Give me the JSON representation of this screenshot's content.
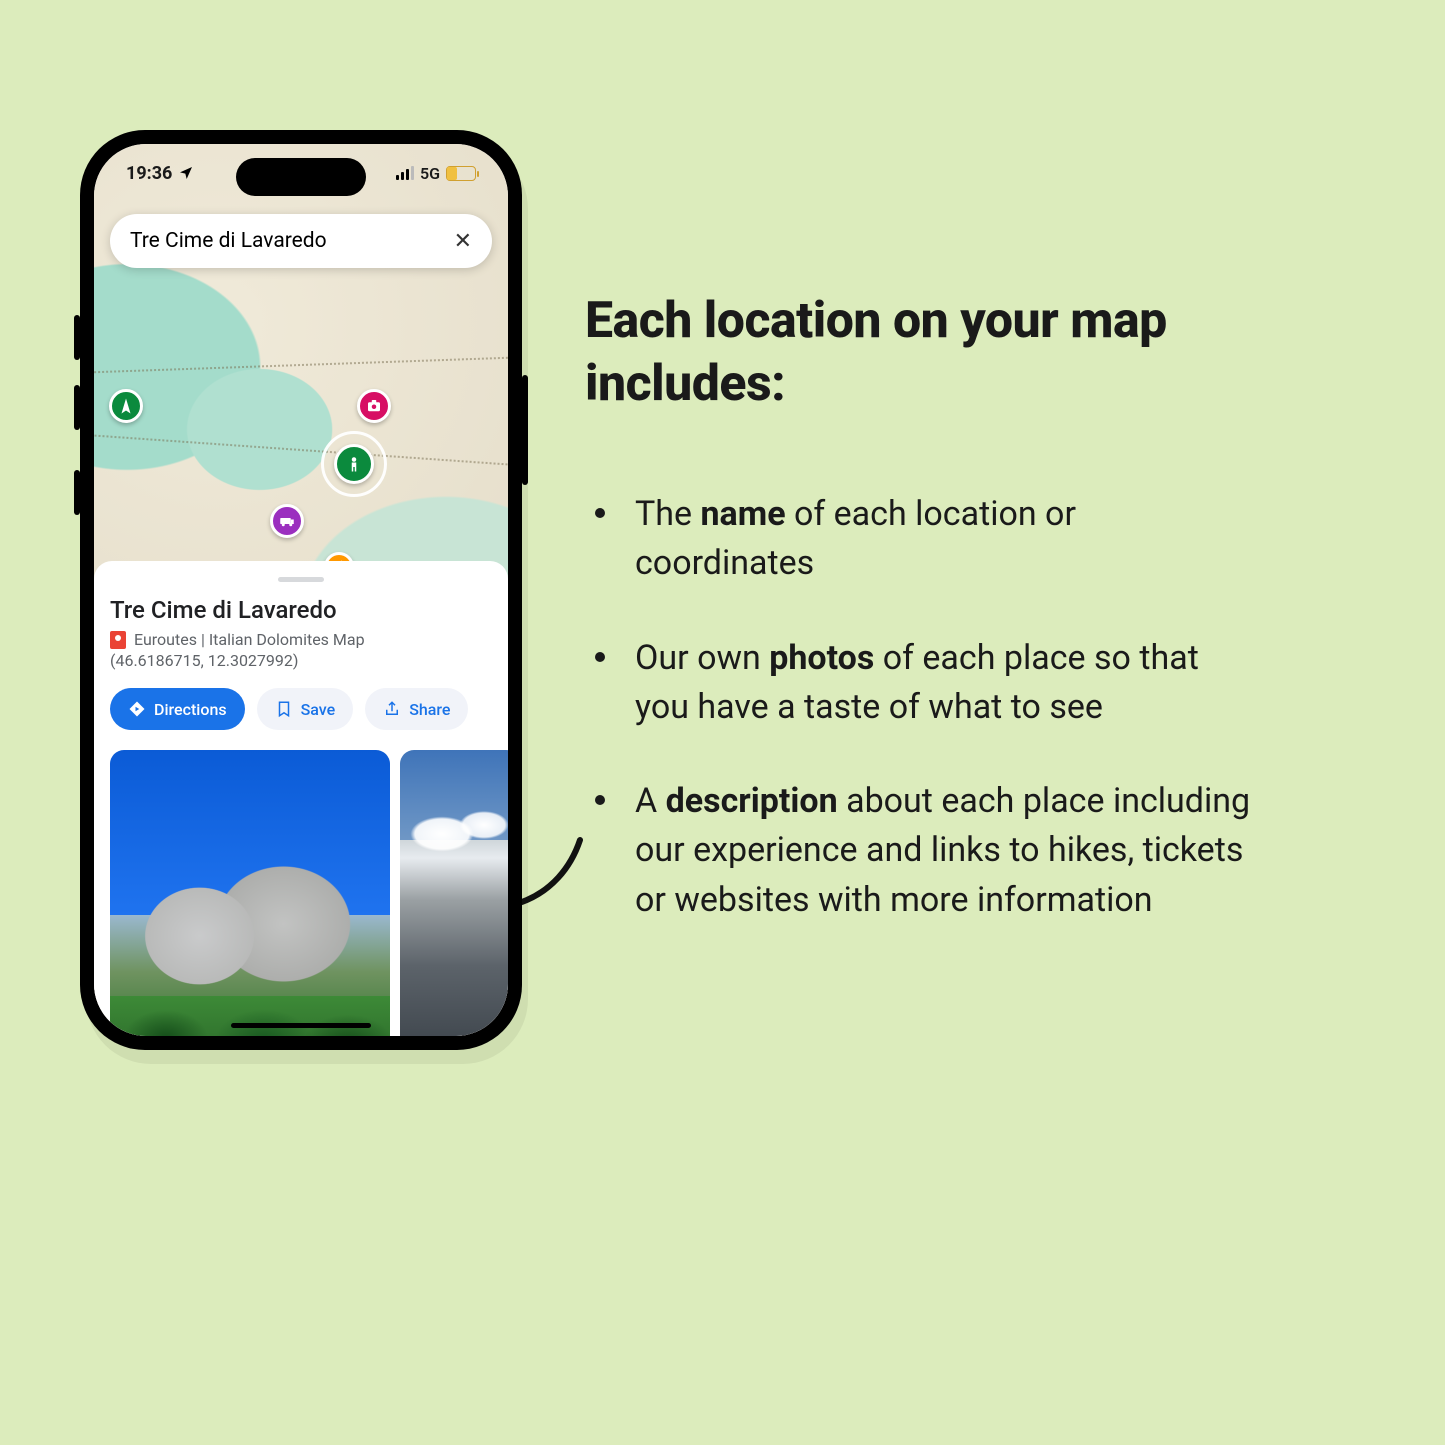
{
  "copy": {
    "headline": "Each location on your map includes:",
    "bullets": [
      {
        "lead": "The ",
        "bold": "name",
        "rest": " of each location or coordinates"
      },
      {
        "lead": "Our own ",
        "bold": "photos",
        "rest": " of each place so that you have a taste of what to see"
      },
      {
        "lead": "A ",
        "bold": "description",
        "rest": " about each place including our experience and links to hikes, tickets or websites with more information"
      }
    ]
  },
  "phone": {
    "status": {
      "time": "19:36",
      "network": "5G"
    },
    "search": {
      "query": "Tre Cime di Lavaredo"
    },
    "place": {
      "title": "Tre Cime di Lavaredo",
      "source": "Euroutes | Italian Dolomites Map",
      "coords": "(46.6186715, 12.3027992)"
    },
    "actions": {
      "directions": "Directions",
      "save": "Save",
      "share": "Share"
    },
    "pins": {
      "green": "hiking-pin",
      "magenta": "photo-pin",
      "center": "hiking-pin-selected",
      "purple": "camper-pin",
      "orange": "food-pin"
    }
  }
}
